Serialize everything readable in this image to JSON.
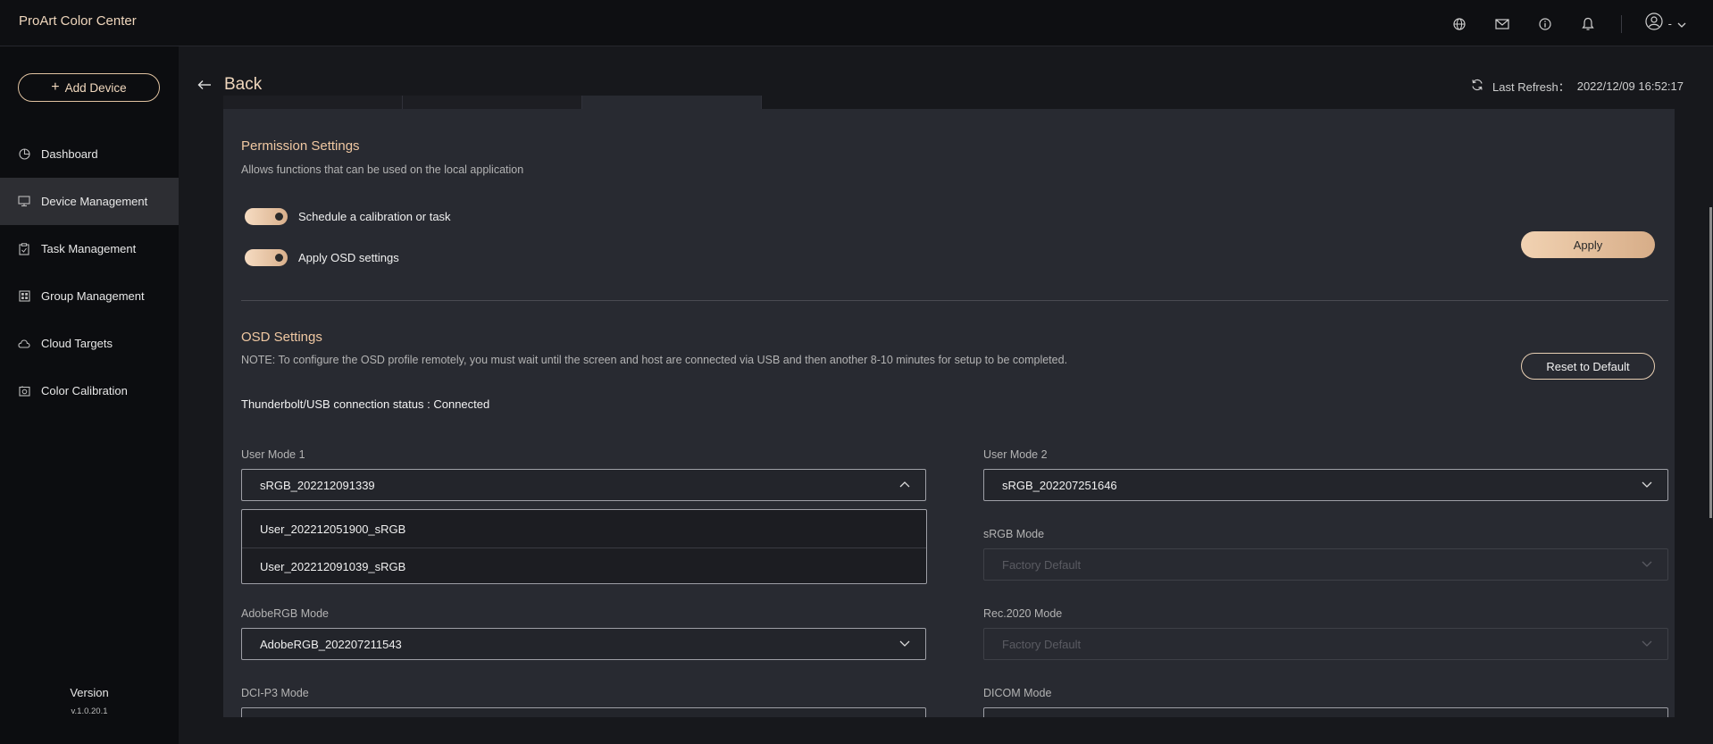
{
  "app": {
    "title": "ProArt Color Center"
  },
  "topbar": {
    "icons": [
      "globe-icon",
      "mail-icon",
      "info-icon",
      "bell-icon",
      "user-icon"
    ],
    "user_suffix": "-"
  },
  "sidebar": {
    "add_device_label": "Add Device",
    "items": [
      {
        "label": "Dashboard",
        "icon": "dashboard-icon",
        "active": false
      },
      {
        "label": "Device Management",
        "icon": "monitor-icon",
        "active": true
      },
      {
        "label": "Task Management",
        "icon": "clipboard-icon",
        "active": false
      },
      {
        "label": "Group Management",
        "icon": "grid-icon",
        "active": false
      },
      {
        "label": "Cloud Targets",
        "icon": "cloud-icon",
        "active": false
      },
      {
        "label": "Color Calibration",
        "icon": "calibration-icon",
        "active": false
      }
    ],
    "version_label": "Version",
    "version_number": "v.1.0.20.1"
  },
  "header": {
    "back_label": "Back",
    "last_refresh_label": "Last Refresh：",
    "last_refresh_value": "2022/12/09 16:52:17"
  },
  "permission": {
    "title": "Permission Settings",
    "description": "Allows functions that can be used on the local application",
    "toggles": [
      {
        "label": "Schedule a calibration or task",
        "on": true
      },
      {
        "label": "Apply OSD settings",
        "on": true
      }
    ],
    "apply_label": "Apply"
  },
  "osd": {
    "title": "OSD Settings",
    "note": "NOTE: To configure the OSD profile remotely, you must wait until the screen and host are connected via USB and then another 8-10 minutes for setup to be completed.",
    "reset_label": "Reset to Default",
    "connection_status": "Thunderbolt/USB connection status : Connected",
    "fields": {
      "user_mode_1": {
        "label": "User Mode 1",
        "value": "sRGB_202212091339",
        "open": true
      },
      "user_mode_2": {
        "label": "User Mode 2",
        "value": "sRGB_202207251646"
      },
      "srgb_mode": {
        "label": "sRGB Mode",
        "value": "Factory Default",
        "disabled": true
      },
      "adobergb_mode": {
        "label": "AdobeRGB Mode",
        "value": "AdobeRGB_202207211543"
      },
      "rec2020_mode": {
        "label": "Rec.2020 Mode",
        "value": "Factory Default",
        "disabled": true
      },
      "dcip3_mode": {
        "label": "DCI-P3 Mode"
      },
      "dicom_mode": {
        "label": "DICOM Mode"
      }
    },
    "dropdown_options": [
      "User_202212051900_sRGB",
      "User_202212091039_sRGB"
    ]
  },
  "colors": {
    "accent": "#f0c8a2",
    "background": "#17181c",
    "panel": "#282a31",
    "sidebar": "#0c0d10"
  }
}
